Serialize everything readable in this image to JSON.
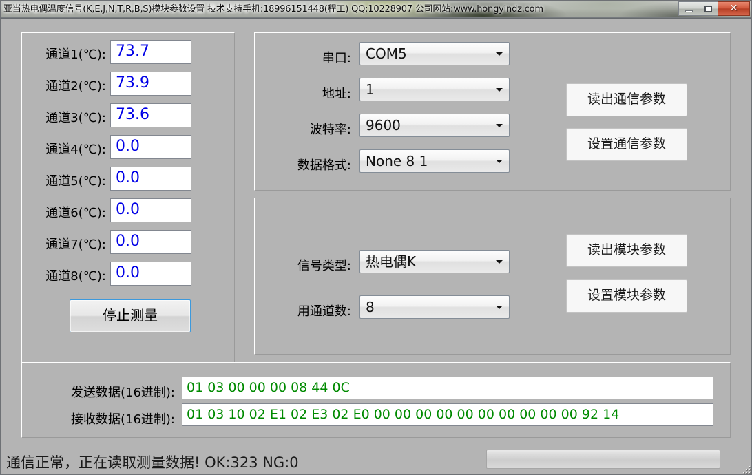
{
  "window": {
    "title": "亚当热电偶温度信号(K,E,J,N,T,R,B,S)模块参数设置    技术支持手机:18996151448(程工)  QQ:10228907   公司网站:www.hongyindz.com",
    "controls": {
      "minimize": "minimize-icon",
      "maximize": "maximize-icon",
      "close": "✕"
    }
  },
  "channels": {
    "rows": [
      {
        "label": "通道1(℃):",
        "value": "73.7"
      },
      {
        "label": "通道2(℃):",
        "value": "73.9"
      },
      {
        "label": "通道3(℃):",
        "value": "73.6"
      },
      {
        "label": "通道4(℃):",
        "value": "0.0"
      },
      {
        "label": "通道5(℃):",
        "value": "0.0"
      },
      {
        "label": "通道6(℃):",
        "value": "0.0"
      },
      {
        "label": "通道7(℃):",
        "value": "0.0"
      },
      {
        "label": "通道8(℃):",
        "value": "0.0"
      }
    ],
    "stop_button": "停止测量"
  },
  "communication": {
    "fields": [
      {
        "label": "串口:",
        "value": "COM5"
      },
      {
        "label": "地址:",
        "value": "1"
      },
      {
        "label": "波特率:",
        "value": "9600"
      },
      {
        "label": "数据格式:",
        "value": "None 8 1"
      }
    ],
    "read_button": "读出通信参数",
    "set_button": "设置通信参数"
  },
  "module": {
    "fields": [
      {
        "label": "信号类型:",
        "value": "热电偶K"
      },
      {
        "label": "用通道数:",
        "value": "8"
      }
    ],
    "read_button": "读出模块参数",
    "set_button": "设置模块参数"
  },
  "data_log": {
    "send_label": "发送数据(16进制):",
    "send_value": "01 03 00 00 00 08 44 0C",
    "recv_label": "接收数据(16进制):",
    "recv_value": "01 03 10 02 E1 02 E3 02 E0 00 00 00 00 00 00 00 00 00 00 92 14"
  },
  "status": {
    "message": "通信正常，正在读取测量数据!  OK:323  NG:0",
    "progress_percent": 0
  },
  "colors": {
    "window_bg": "#b4b4b4",
    "value_text": "#0000e6",
    "hex_text": "#008a00",
    "focus_border": "#3c99dc",
    "close_button": "#c44a2d"
  }
}
